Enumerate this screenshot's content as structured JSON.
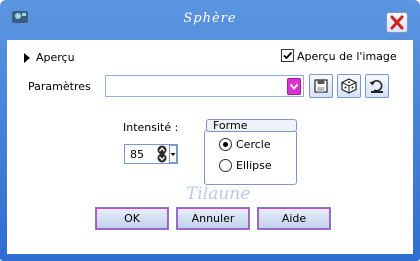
{
  "window": {
    "title": "Sphère",
    "accent": "#2f6ed1"
  },
  "preview": {
    "label": "Aperçu",
    "checkbox_label": "Aperçu de l'image",
    "checked": true
  },
  "params": {
    "label": "Paramètres",
    "value": ""
  },
  "toolbar": [
    "save-icon",
    "random-dice-icon",
    "reset-icon"
  ],
  "intensity": {
    "label": "Intensité :",
    "value": "85"
  },
  "shape_group": {
    "title": "Forme",
    "options": [
      {
        "label": "Cercle",
        "selected": true
      },
      {
        "label": "Ellipse",
        "selected": false
      }
    ]
  },
  "watermark": "Tilaune",
  "buttons": {
    "ok": "OK",
    "cancel": "Annuler",
    "help": "Aide"
  }
}
